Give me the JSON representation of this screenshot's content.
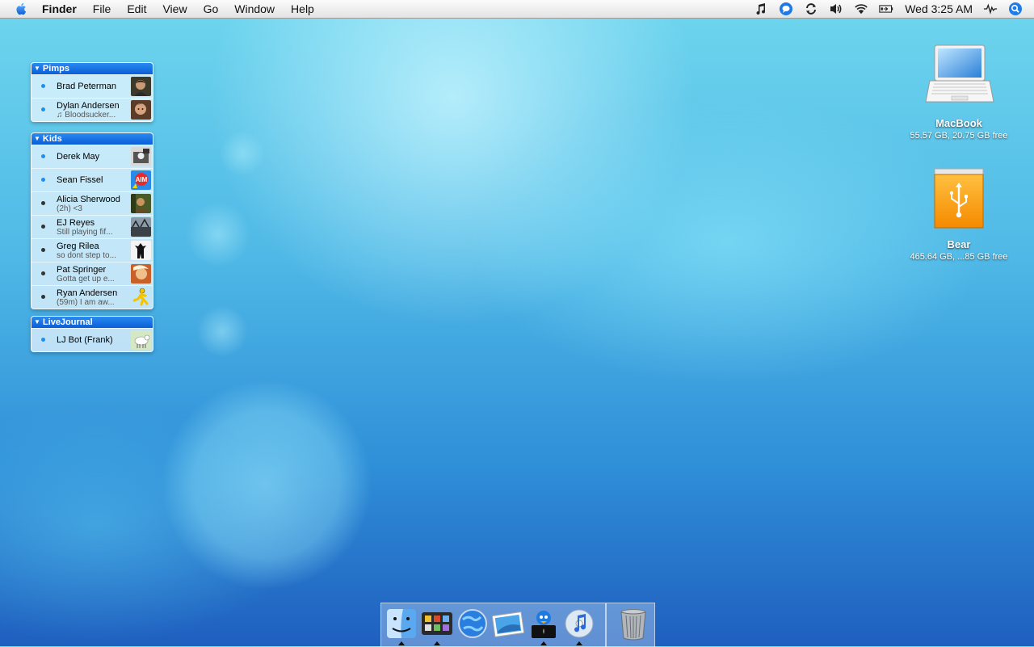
{
  "menubar": {
    "app_name": "Finder",
    "menus": [
      "File",
      "Edit",
      "View",
      "Go",
      "Window",
      "Help"
    ],
    "status_icons": [
      "music-note-icon",
      "messenger-icon",
      "sync-icon",
      "volume-icon",
      "wifi-icon",
      "battery-icon",
      "activity-icon",
      "spotlight-icon"
    ],
    "clock": "Wed 3:25 AM"
  },
  "buddy_groups": [
    {
      "name": "Pimps",
      "buddies": [
        {
          "name": "Brad Peterman",
          "status": ""
        },
        {
          "name": "Dylan Andersen",
          "status": "♫ Bloodsucker..."
        }
      ]
    },
    {
      "name": "Kids",
      "buddies": [
        {
          "name": "Derek May",
          "status": ""
        },
        {
          "name": "Sean Fissel",
          "status": ""
        },
        {
          "name": "Alicia Sherwood",
          "status": "(2h) <3"
        },
        {
          "name": "EJ Reyes",
          "status": "Still playing fif..."
        },
        {
          "name": "Greg Rilea",
          "status": "so dont step to..."
        },
        {
          "name": "Pat Springer",
          "status": "Gotta get up e..."
        },
        {
          "name": "Ryan Andersen",
          "status": "(59m) I am aw..."
        }
      ]
    },
    {
      "name": "LiveJournal",
      "buddies": [
        {
          "name": "LJ Bot (Frank)",
          "status": ""
        }
      ]
    }
  ],
  "avatars": {
    "aim_badge": "AIM"
  },
  "desktop": {
    "macbook": {
      "label": "MacBook",
      "info": "55.57 GB, 20.75 GB free"
    },
    "bear": {
      "label": "Bear",
      "info": "465.64 GB, ...85 GB free"
    }
  },
  "dock": {
    "items": [
      "finder-icon",
      "dashboard-icon",
      "safari-icon",
      "preview-icon",
      "adium-icon",
      "itunes-icon",
      "trash-icon"
    ]
  },
  "colors": {
    "online": "#1f8ef1",
    "away": "#333333",
    "header": "#0a66e0"
  }
}
